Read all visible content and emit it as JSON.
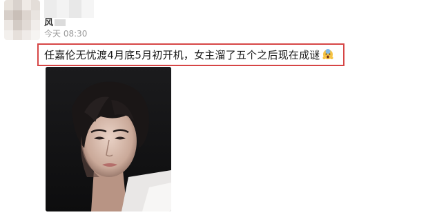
{
  "post": {
    "username_partial": "风",
    "timestamp": "今天 08:30",
    "message": "任嘉伦无忧渡4月底5月初开机，女主溜了五个之后现在成谜",
    "emoji_icon": "scream-emoji-icon",
    "photo_icon": "portrait-photo"
  },
  "colors": {
    "highlight_border": "#d64545",
    "timestamp": "#9a9a9a",
    "text": "#1a1a1a"
  }
}
